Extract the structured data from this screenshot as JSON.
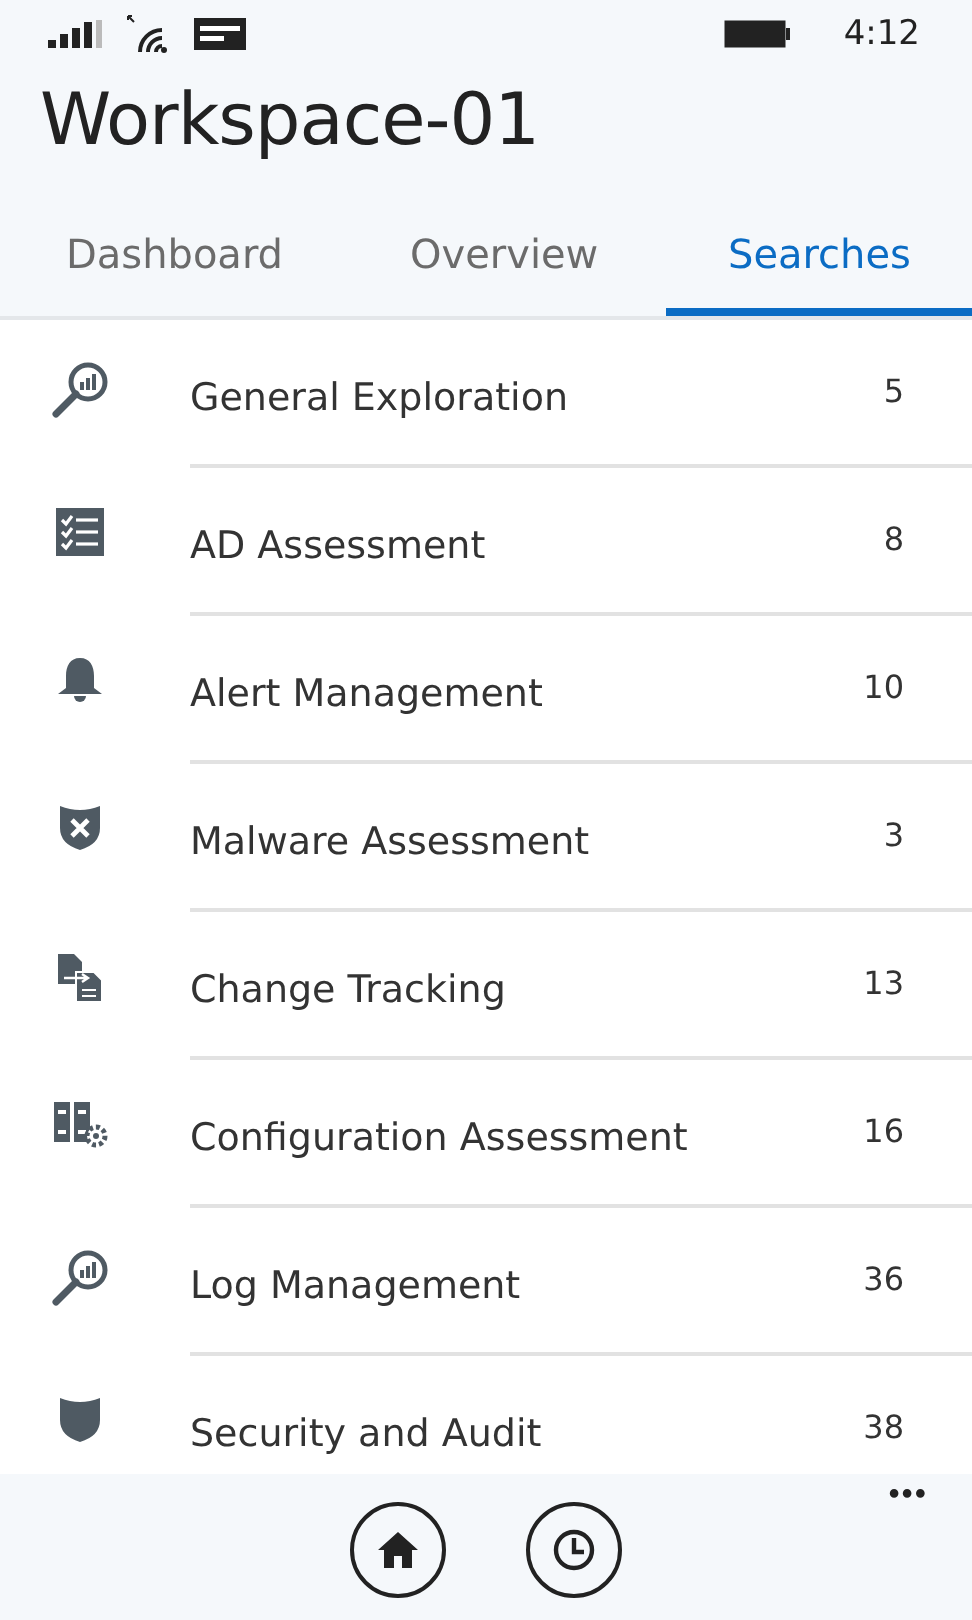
{
  "status_bar": {
    "time": "4:12"
  },
  "title": "Workspace-01",
  "tabs": [
    {
      "label": "Dashboard",
      "selected": false
    },
    {
      "label": "Overview",
      "selected": false
    },
    {
      "label": "Searches",
      "selected": true
    }
  ],
  "searches": [
    {
      "kind": "search-chart",
      "label": "General Exploration",
      "count": "5"
    },
    {
      "kind": "checklist",
      "label": "AD Assessment",
      "count": "8"
    },
    {
      "kind": "bell",
      "label": "Alert Management",
      "count": "10"
    },
    {
      "kind": "shield-x",
      "label": "Malware Assessment",
      "count": "3"
    },
    {
      "kind": "documents",
      "label": "Change Tracking",
      "count": "13"
    },
    {
      "kind": "server-gear",
      "label": "Configuration Assessment",
      "count": "16"
    },
    {
      "kind": "search-chart",
      "label": "Log Management",
      "count": "36"
    },
    {
      "kind": "shield",
      "label": "Security and Audit",
      "count": "38"
    }
  ],
  "app_bar": {
    "more": "•••"
  }
}
